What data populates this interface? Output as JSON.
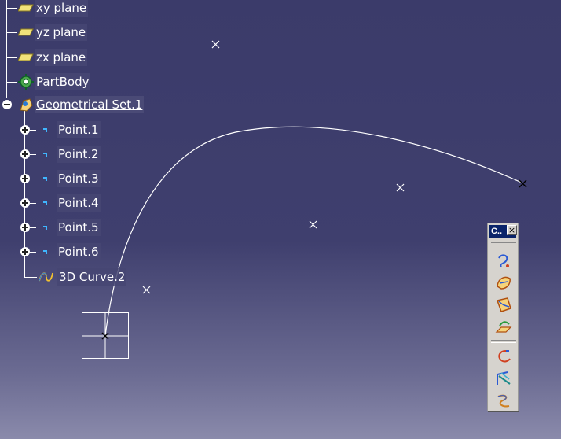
{
  "tree": {
    "planes": [
      {
        "label": "xy plane"
      },
      {
        "label": "yz plane"
      },
      {
        "label": "zx plane"
      }
    ],
    "part_body": {
      "label": "PartBody"
    },
    "geometrical_set": {
      "label": "Geometrical Set.1"
    },
    "points": [
      {
        "label": "Point.1"
      },
      {
        "label": "Point.2"
      },
      {
        "label": "Point.3"
      },
      {
        "label": "Point.4"
      },
      {
        "label": "Point.5"
      },
      {
        "label": "Point.6"
      }
    ],
    "curve": {
      "label": "3D Curve.2"
    }
  },
  "toolbar": {
    "title": "C..",
    "close_glyph": "×",
    "buttons": [
      {
        "name": "3d-curve-icon"
      },
      {
        "name": "surface-fill-icon"
      },
      {
        "name": "surface-patch-icon"
      },
      {
        "name": "planar-surface-icon"
      },
      {
        "name": "curve-connect-icon"
      },
      {
        "name": "curve-from-surface-icon"
      },
      {
        "name": "spline-icon"
      }
    ]
  },
  "colors": {
    "background_top": "#3b3b6a",
    "background_bottom": "#8a8aab",
    "curve": "#ffffff",
    "toolbar_title": "#0a246a"
  }
}
